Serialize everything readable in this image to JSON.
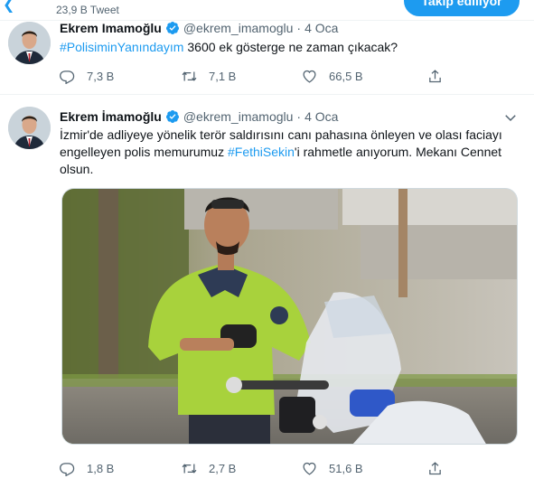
{
  "header": {
    "tweet_count": "23,9 B Tweet",
    "follow_label": "Takip ediliyor"
  },
  "tweets": [
    {
      "name": "Ekrem Imamoğlu",
      "handle": "@ekrem_imamoglu",
      "separator": "·",
      "date": "4 Oca",
      "hashtag": "#PolisiminYanındayım",
      "text": " 3600 ek gösterge ne zaman çıkacak?",
      "replies": "7,3 B",
      "retweets": "7,1 B",
      "likes": "66,5 B"
    },
    {
      "name": "Ekrem İmamoğlu",
      "handle": "@ekrem_imamoglu",
      "separator": "·",
      "date": "4 Oca",
      "text_part1": "İzmir'de adliyeye yönelik terör saldırısını canı pahasına önleyen ve olası faciayı engelleyen polis memurumuz ",
      "hashtag": "#FethiSekin",
      "text_part2": "'i rahmetle anıyorum. Mekanı Cennet olsun.",
      "replies": "1,8 B",
      "retweets": "2,7 B",
      "likes": "51,6 B"
    }
  ],
  "icons": {
    "back": "back-arrow-icon",
    "verified": "verified-badge-icon",
    "more": "chevron-down-icon",
    "reply": "reply-icon",
    "retweet": "retweet-icon",
    "like": "heart-icon",
    "share": "share-icon"
  },
  "colors": {
    "accent": "#1d9bf0",
    "secondary_text": "#536471",
    "primary_text": "#0f1419"
  }
}
